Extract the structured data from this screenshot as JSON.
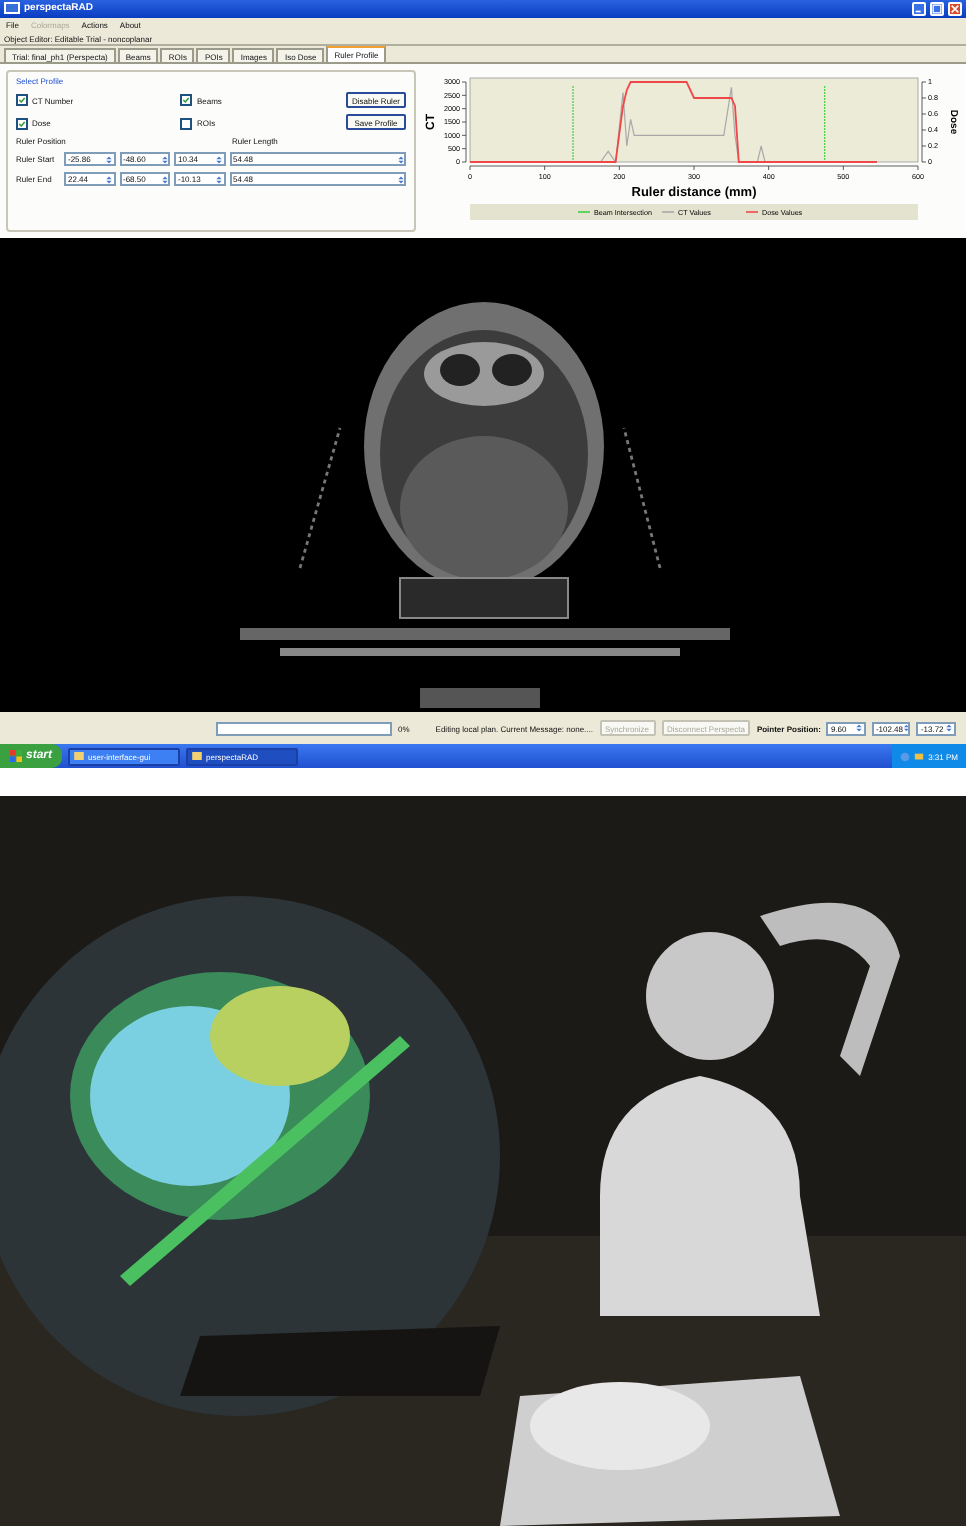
{
  "window": {
    "title": "perspectaRAD"
  },
  "menu": [
    {
      "label": "File",
      "disabled": false
    },
    {
      "label": "Colormaps",
      "disabled": true
    },
    {
      "label": "Actions",
      "disabled": false
    },
    {
      "label": "About",
      "disabled": false
    }
  ],
  "object_editor": "Object Editor: Editable Trial - noncoplanar",
  "tabs": [
    {
      "label": "Trial: final_ph1 (Perspecta)",
      "selected": false
    },
    {
      "label": "Beams",
      "selected": false
    },
    {
      "label": "ROIs",
      "selected": false
    },
    {
      "label": "POIs",
      "selected": false
    },
    {
      "label": "Images",
      "selected": false
    },
    {
      "label": "Iso Dose",
      "selected": false
    },
    {
      "label": "Ruler Profile",
      "selected": true
    }
  ],
  "profile": {
    "title": "Select Profile",
    "checks": [
      {
        "label": "CT Number",
        "checked": true
      },
      {
        "label": "Beams",
        "checked": true
      },
      {
        "label": "Dose",
        "checked": true
      },
      {
        "label": "ROIs",
        "checked": false
      }
    ],
    "buttons": [
      "Disable Ruler",
      "Save Profile"
    ],
    "position_label": "Ruler Position",
    "length_label": "Ruler Length",
    "rows": [
      {
        "label": "Ruler Start",
        "values": [
          "-25.86",
          "-48.60",
          "10.34"
        ],
        "length": "54.48"
      },
      {
        "label": "Ruler End",
        "values": [
          "22.44",
          "-68.50",
          "-10.13"
        ],
        "length": "54.48"
      }
    ]
  },
  "chart": {
    "chart_data": {
      "type": "line",
      "xlabel": "Ruler distance (mm)",
      "ylabel": "CT",
      "y2label": "Dose",
      "x": [
        0,
        175,
        185,
        195,
        205,
        210,
        215,
        220,
        225,
        230,
        290,
        300,
        340,
        350,
        355,
        360,
        385,
        390,
        395,
        545
      ],
      "series": [
        {
          "name": "CT Values",
          "color": "#a8a8a8",
          "values": [
            0,
            0,
            400,
            0,
            2600,
            600,
            1600,
            1000,
            1000,
            1000,
            1000,
            1000,
            1000,
            2800,
            1000,
            0,
            0,
            600,
            0,
            0
          ]
        },
        {
          "name": "Dose Values",
          "axis": "y2",
          "color": "#f04848",
          "values": [
            0,
            0,
            0,
            0,
            0.7,
            0.9,
            1,
            1,
            1,
            1,
            1,
            0.8,
            0.8,
            0.8,
            0.7,
            0,
            0,
            0,
            0,
            0
          ]
        }
      ],
      "ref_lines": [
        {
          "axis": "x",
          "value": 138,
          "label": "Beam Intersection",
          "color": "#40d040"
        },
        {
          "axis": "x",
          "value": 475,
          "color": "#40d040"
        }
      ],
      "legend": "bottom",
      "xlim": [
        0,
        600
      ],
      "ylim": [
        0,
        3000
      ],
      "y2lim": [
        0,
        1
      ],
      "xticks": [
        0,
        100,
        200,
        300,
        400,
        500,
        600
      ],
      "yticks": [
        0,
        500,
        1000,
        1500,
        2000,
        2500,
        3000
      ],
      "y2ticks": [
        0,
        0.2,
        0.4,
        0.6,
        0.8,
        1
      ]
    }
  },
  "status": {
    "progress_bar": {
      "level": 0
    },
    "progress": "0%",
    "message": "Editing local plan. Current Message: none....",
    "buttons": [
      {
        "label": "Synchronize",
        "disabled": true
      },
      {
        "label": "Disconnect Perspecta",
        "disabled": true
      }
    ],
    "pointer_label": "Pointer Position:",
    "pointer": [
      "9.60",
      "-102.48",
      "-13.72"
    ]
  },
  "taskbar": {
    "start": "start",
    "tasks": [
      {
        "label": "user-interface-gui",
        "selected": false
      },
      {
        "label": "perspectaRAD",
        "selected": true
      }
    ],
    "clock": "3:31 PM"
  }
}
